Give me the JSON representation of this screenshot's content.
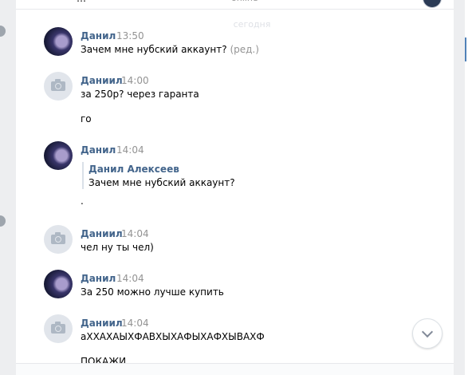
{
  "header": {
    "clipped_prev_message": "…",
    "status_text": "online",
    "date_separator": "сегодня"
  },
  "messages": [
    {
      "author": "Данил",
      "time": "13:50",
      "avatar": "user-photo",
      "lines": [
        "Зачем мне нубский аккаунт?"
      ],
      "edited": "(ред.)"
    },
    {
      "author": "Даниил",
      "time": "14:00",
      "avatar": "camera-icon",
      "lines": [
        "за 250р? через гаранта",
        "го"
      ]
    },
    {
      "author": "Данил",
      "time": "14:04",
      "avatar": "user-photo",
      "quote": {
        "author": "Данил Алексеев",
        "text": "Зачем мне нубский аккаунт?"
      },
      "lines": [
        "."
      ]
    },
    {
      "author": "Даниил",
      "time": "14:04",
      "avatar": "camera-icon",
      "lines": [
        "чел ну ты чел)"
      ]
    },
    {
      "author": "Данил",
      "time": "14:04",
      "avatar": "user-photo",
      "lines": [
        "За 250 можно лучше купить"
      ]
    },
    {
      "author": "Даниил",
      "time": "14:04",
      "avatar": "camera-icon",
      "lines": [
        "аХХАХАЫХФАВХЫХАФЫХАФХЫВАХФ",
        "ПОКАЖИ"
      ]
    }
  ],
  "controls": {
    "scroll_down_icon": "chevron-down-icon"
  },
  "colors": {
    "author": "#42648b",
    "time": "#939393",
    "background": "#edeef0",
    "accent": "#5181b8"
  }
}
